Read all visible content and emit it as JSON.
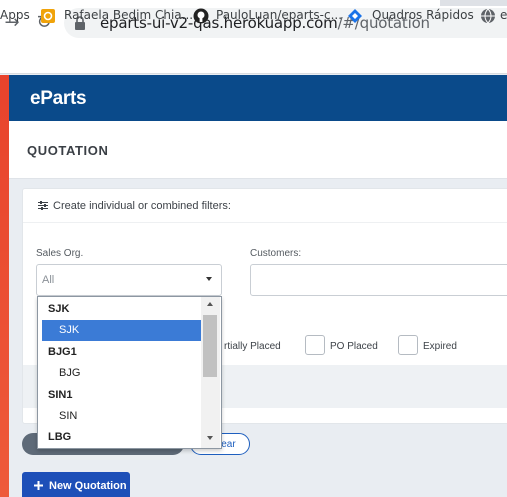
{
  "browser": {
    "url_host": "eparts-ui-v2-qas.herokuapp.com",
    "url_path": "/#/quotation",
    "bookmarks": [
      {
        "label": "Apps",
        "icon": "apps-icon"
      },
      {
        "label": "Rafaela Bedim Chia...",
        "icon": "bookmark-orange-icon"
      },
      {
        "label": "PauloLuan/eparts-c...",
        "icon": "github-icon"
      },
      {
        "label": "Quadros Rápidos",
        "icon": "diamond-icon"
      },
      {
        "label": "e",
        "icon": "globe-icon"
      }
    ]
  },
  "app": {
    "logo": "eParts",
    "page_title": "QUOTATION",
    "brand_color": "#0a4a8a",
    "accent_color": "#3b7bd6"
  },
  "filters": {
    "header": "Create individual or combined filters:",
    "sales_org_label": "Sales Org.",
    "sales_org_value": "All",
    "customers_label": "Customers:",
    "status_options": [
      "rtially Placed",
      "PO Placed",
      "Expired"
    ]
  },
  "dropdown": {
    "items": [
      {
        "label": "SJK",
        "kind": "group",
        "selected": false
      },
      {
        "label": "SJK",
        "kind": "child",
        "selected": true
      },
      {
        "label": "BJG1",
        "kind": "group",
        "selected": false
      },
      {
        "label": "BJG",
        "kind": "child",
        "selected": false
      },
      {
        "label": "SIN1",
        "kind": "group",
        "selected": false
      },
      {
        "label": "SIN",
        "kind": "child",
        "selected": false
      },
      {
        "label": "LBG",
        "kind": "group",
        "selected": false
      }
    ]
  },
  "buttons": {
    "clear": "lear",
    "new_quotation": "New Quotation",
    "new_quotation_icon": "plus-icon"
  }
}
